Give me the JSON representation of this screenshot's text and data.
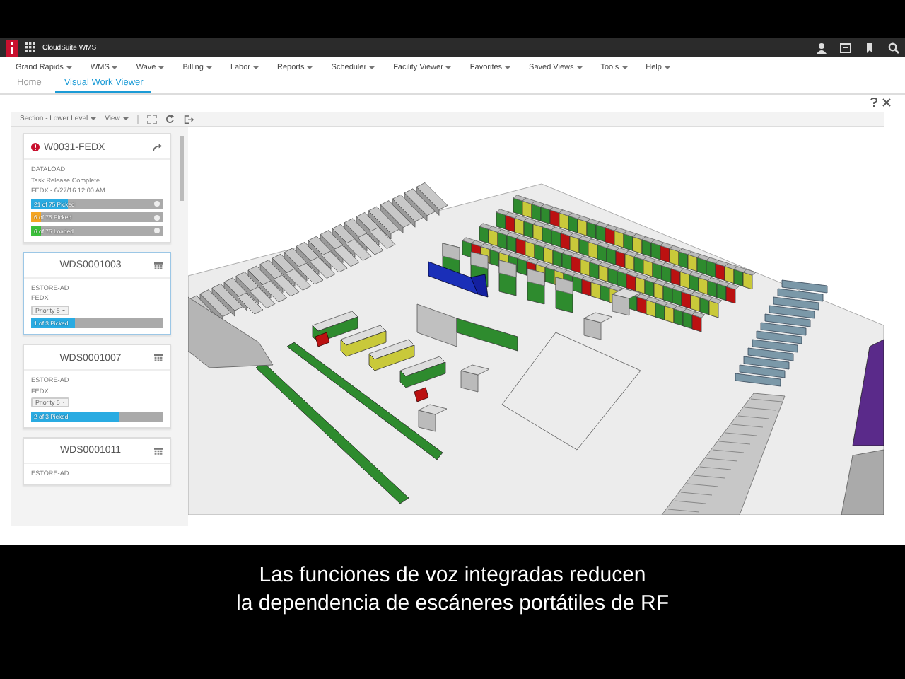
{
  "app": {
    "title": "CloudSuite WMS"
  },
  "menu": [
    {
      "label": "Grand Rapids"
    },
    {
      "label": "WMS"
    },
    {
      "label": "Wave"
    },
    {
      "label": "Billing"
    },
    {
      "label": "Labor"
    },
    {
      "label": "Reports"
    },
    {
      "label": "Scheduler"
    },
    {
      "label": "Facility Viewer"
    },
    {
      "label": "Favorites"
    },
    {
      "label": "Saved Views"
    },
    {
      "label": "Tools"
    },
    {
      "label": "Help"
    }
  ],
  "tabs": [
    {
      "label": "Home",
      "selected": false
    },
    {
      "label": "Visual Work Viewer",
      "selected": true
    }
  ],
  "toolbar": {
    "section": "Section - Lower Level",
    "view": "View"
  },
  "cards": [
    {
      "kind": "wave",
      "title": "W0031-FEDX",
      "selected": false,
      "lines": [
        "DATALOAD",
        "Task Release Complete",
        "FEDX - 6/27/16 12:00 AM"
      ],
      "bars": [
        {
          "label": "21 of 75 Picked",
          "level": 0.28,
          "color": "#29abe2"
        },
        {
          "label": "6 of 75 Picked",
          "level": 0.08,
          "color": "#f5a623"
        },
        {
          "label": "6 of 75 Loaded",
          "level": 0.08,
          "color": "#3cc13b"
        }
      ]
    },
    {
      "kind": "shipment",
      "title": "WDS0001003",
      "selected": true,
      "lines": [
        "ESTORE-AD",
        "FEDX"
      ],
      "priority": "Priority 5",
      "bars": [
        {
          "label": "1 of 3 Picked",
          "level": 0.33,
          "color": "#29abe2"
        }
      ]
    },
    {
      "kind": "shipment",
      "title": "WDS0001007",
      "selected": false,
      "lines": [
        "ESTORE-AD",
        "FEDX"
      ],
      "priority": "Priority 5",
      "bars": [
        {
          "label": "2 of 3 Picked",
          "level": 0.67,
          "color": "#29abe2"
        }
      ]
    },
    {
      "kind": "shipment",
      "title": "WDS0001011",
      "selected": false,
      "lines": [
        "ESTORE-AD"
      ]
    }
  ],
  "caption": [
    "Las funciones de voz integradas reducen",
    "la dependencia de escáneres portátiles de RF"
  ]
}
